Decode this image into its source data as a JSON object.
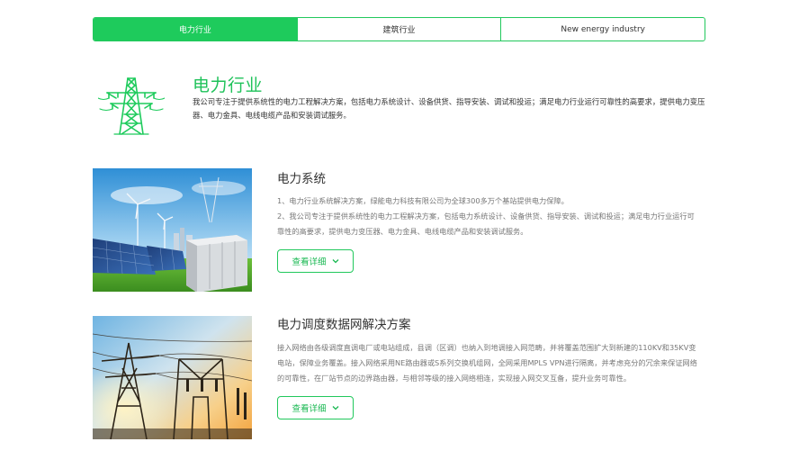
{
  "tabs": [
    {
      "label": "电力行业",
      "active": true
    },
    {
      "label": "建筑行业",
      "active": false
    },
    {
      "label": "New energy industry",
      "active": false
    }
  ],
  "intro": {
    "title": "电力行业",
    "description": "我公司专注于提供系统性的电力工程解决方案，包括电力系统设计、设备供货、指导安装、调试和投运；满足电力行业运行可靠性的高要求，提供电力变压器、电力金具、电线电缆产品和安装调试服务。",
    "icon": "transmission-tower-icon"
  },
  "items": [
    {
      "title": "电力系统",
      "paragraphs": [
        "1、电力行业系统解决方案，绿能电力科技有限公司为全球300多万个基站提供电力保障。",
        "2、我公司专注于提供系统性的电力工程解决方案，包括电力系统设计、设备供货、指导安装、调试和投运；满足电力行业运行可靠性的高要求，提供电力变压器、电力金具、电线电缆产品和安装调试服务。"
      ],
      "button": "查看详细"
    },
    {
      "title": "电力调度数据网解决方案",
      "paragraphs": [
        "接入网络由各级调度直调电厂或电站组成，县调（区调）也纳入到地调接入网范畴，并将覆盖范围扩大到新建的110KV和35KV变电站，保障业务覆盖。接入网络采用NE路由器或S系列交换机组网，全网采用MPLS VPN进行隔离，并考虑充分的冗余来保证网络的可靠性，在厂站节点的边界路由器，与相邻等级的接入网络相连，实现接入网交叉互备，提升业务可靠性。"
      ],
      "button": "查看详细"
    }
  ],
  "colors": {
    "accent": "#1ecb5c",
    "text": "#333333",
    "muted": "#777777"
  }
}
